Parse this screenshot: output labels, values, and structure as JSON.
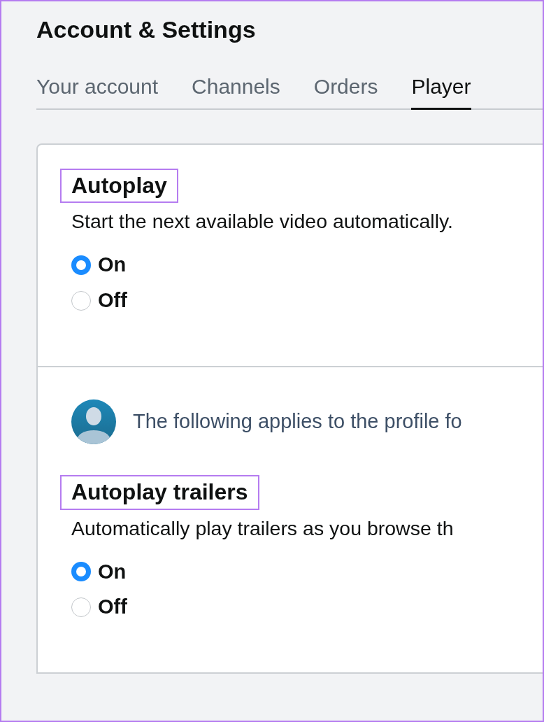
{
  "page": {
    "title": "Account & Settings"
  },
  "tabs": [
    {
      "label": "Your account",
      "selected": false
    },
    {
      "label": "Channels",
      "selected": false
    },
    {
      "label": "Orders",
      "selected": false
    },
    {
      "label": "Player",
      "selected": true
    }
  ],
  "sections": [
    {
      "heading": "Autoplay",
      "highlighted": true,
      "description": "Start the next available video automatically.",
      "options": [
        {
          "label": "On",
          "selected": true
        },
        {
          "label": "Off",
          "selected": false
        }
      ]
    },
    {
      "profile_note": "The following applies to the profile fo",
      "heading": "Autoplay trailers",
      "highlighted": true,
      "description": "Automatically play trailers as you browse th",
      "options": [
        {
          "label": "On",
          "selected": true
        },
        {
          "label": "Off",
          "selected": false
        }
      ]
    }
  ]
}
